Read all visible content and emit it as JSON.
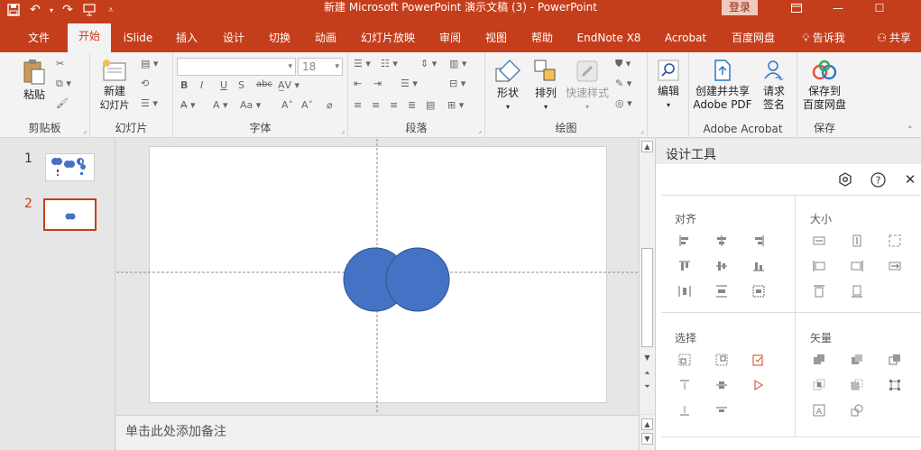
{
  "titlebar": {
    "title": "新建 Microsoft PowerPoint 演示文稿 (3)  -  PowerPoint",
    "login": "登录"
  },
  "tabs": [
    {
      "label": "文件",
      "x": 0
    },
    {
      "label": "开始",
      "x": 0,
      "active": true
    },
    {
      "label": "iSlide"
    },
    {
      "label": "插入"
    },
    {
      "label": "设计"
    },
    {
      "label": "切换"
    },
    {
      "label": "动画"
    },
    {
      "label": "幻灯片放映"
    },
    {
      "label": "审阅"
    },
    {
      "label": "视图"
    },
    {
      "label": "帮助"
    },
    {
      "label": "EndNote X8"
    },
    {
      "label": "Acrobat"
    },
    {
      "label": "百度网盘"
    },
    {
      "label": "告诉我"
    },
    {
      "label": "共享"
    }
  ],
  "ribbon": {
    "clipboard": {
      "paste": "粘贴",
      "group": "剪贴板"
    },
    "slides": {
      "new_slide_1": "新建",
      "new_slide_2": "幻灯片",
      "group": "幻灯片"
    },
    "font": {
      "size": "18",
      "group": "字体"
    },
    "paragraph": {
      "group": "段落"
    },
    "drawing": {
      "shape": "形状",
      "arrange": "排列",
      "quick_style": "快速样式",
      "group": "绘图"
    },
    "editing": {
      "edit": "编辑"
    },
    "acrobat": {
      "create_1": "创建并共享",
      "create_2": "Adobe PDF",
      "request_1": "请求",
      "request_2": "签名",
      "group": "Adobe Acrobat"
    },
    "save": {
      "save_1": "保存到",
      "save_2": "百度网盘",
      "group": "保存"
    }
  },
  "slides": [
    {
      "num": "1"
    },
    {
      "num": "2"
    }
  ],
  "notes_placeholder": "单击此处添加备注",
  "design_pane": {
    "title": "设计工具",
    "align": "对齐",
    "size": "大小",
    "select": "选择",
    "vector": "矢量"
  },
  "colors": {
    "accent": "#c43e1c",
    "shape_fill": "#4472c4",
    "shape_stroke": "#2f528f"
  }
}
